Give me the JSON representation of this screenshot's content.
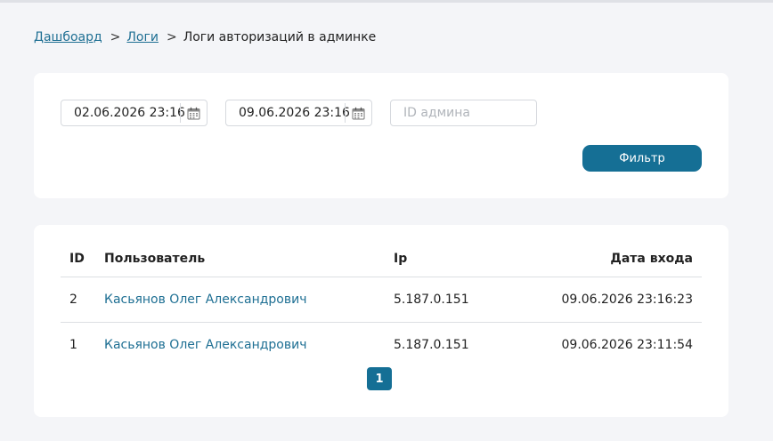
{
  "breadcrumb": {
    "items": [
      {
        "label": "Дашбоард"
      },
      {
        "label": "Логи"
      }
    ],
    "current": "Логи авторизаций в админке"
  },
  "filters": {
    "date_from": "02.06.2026 23:16",
    "date_to": "09.06.2026 23:16",
    "admin_id_placeholder": "ID админа",
    "admin_id_value": "",
    "submit_label": "Фильтр"
  },
  "table": {
    "headers": {
      "id": "ID",
      "user": "Пользователь",
      "ip": "Ip",
      "date": "Дата входа"
    },
    "rows": [
      {
        "id": "2",
        "user": "Касьянов Олег Александрович",
        "ip": "5.187.0.151",
        "date": "09.06.2026 23:16:23"
      },
      {
        "id": "1",
        "user": "Касьянов Олег Александрович",
        "ip": "5.187.0.151",
        "date": "09.06.2026 23:11:54"
      }
    ]
  },
  "pagination": {
    "current_page": "1"
  },
  "colors": {
    "accent": "#156f95",
    "link": "#1e6f93",
    "background": "#f4f5f8"
  },
  "icons": {
    "calendar": "calendar-icon",
    "breadcrumb_separator": "chevron-right-icon"
  }
}
